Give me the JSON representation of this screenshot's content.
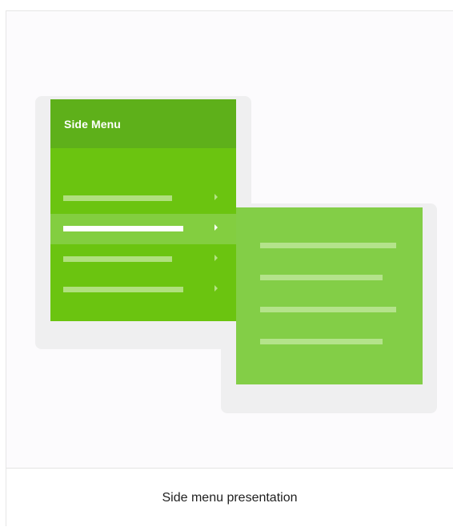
{
  "illustration": {
    "menu_title": "Side Menu",
    "colors": {
      "menu_background": "#6bc410",
      "menu_header": "#5eb01a",
      "active_row": "#83ce40",
      "submenu_background": "#83ce47",
      "placeholder_bar": "#b0e07e",
      "active_bar": "#ffffff"
    },
    "menu_items": [
      {
        "active": false
      },
      {
        "active": true
      },
      {
        "active": false
      },
      {
        "active": false
      }
    ],
    "submenu_items": [
      {
        "active": false
      },
      {
        "active": false
      },
      {
        "active": false
      },
      {
        "active": false
      }
    ]
  },
  "caption": "Side menu presentation"
}
